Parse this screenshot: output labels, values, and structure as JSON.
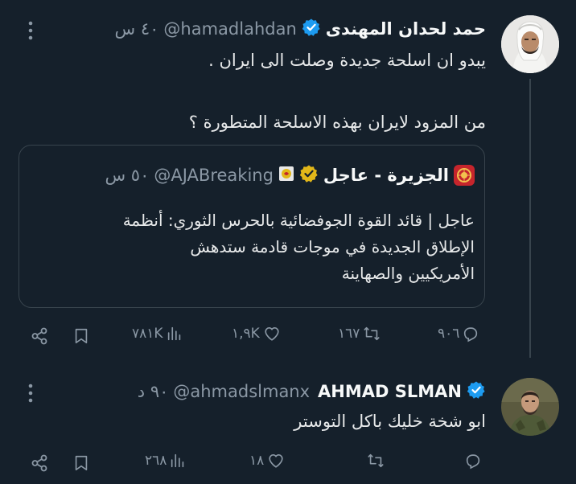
{
  "tweet1": {
    "name": "حمد لحدان المهندى",
    "handle": "@hamadlahdan",
    "time": "٤٠ س",
    "text_line1": "يبدو ان اسلحة جديدة وصلت الى ايران .",
    "text_line2": "من المزود لايران بهذه الاسلحة المتطورة ؟",
    "quote": {
      "name": "الجزيرة - عاجل",
      "handle": "@AJABreaking",
      "time": "٥٠ س",
      "line1": "عاجل | قائد القوة الجوفضائية بالحرس الثوري: أنظمة",
      "line2": "الإطلاق الجديدة في موجات قادمة ستدهش",
      "line3": "الأمريكيين والصهاينة"
    },
    "actions": {
      "replies": "٩٠٦",
      "retweets": "١٦٧",
      "likes": "١,٩K",
      "views": "٧٨١K"
    }
  },
  "tweet2": {
    "name": "AHMAD SLMAN",
    "handle": "@ahmadslmanx",
    "time": "٩٠ د",
    "text": "ابو شخة خليك باكل التوستر",
    "actions": {
      "replies": "",
      "retweets": "",
      "likes": "١٨",
      "views": "٢٦٨"
    }
  },
  "colors": {
    "background": "#15202b",
    "verified_blue": "#1d9bf0",
    "verified_gold": "#e2b719",
    "aj_logo": "#c6252c",
    "secondary_text": "#8b98a5"
  },
  "icons": [
    "more-icon",
    "verified-icon",
    "reply-icon",
    "retweet-icon",
    "like-icon",
    "views-icon",
    "bookmark-icon",
    "share-icon",
    "aljazeera-logo-icon"
  ]
}
